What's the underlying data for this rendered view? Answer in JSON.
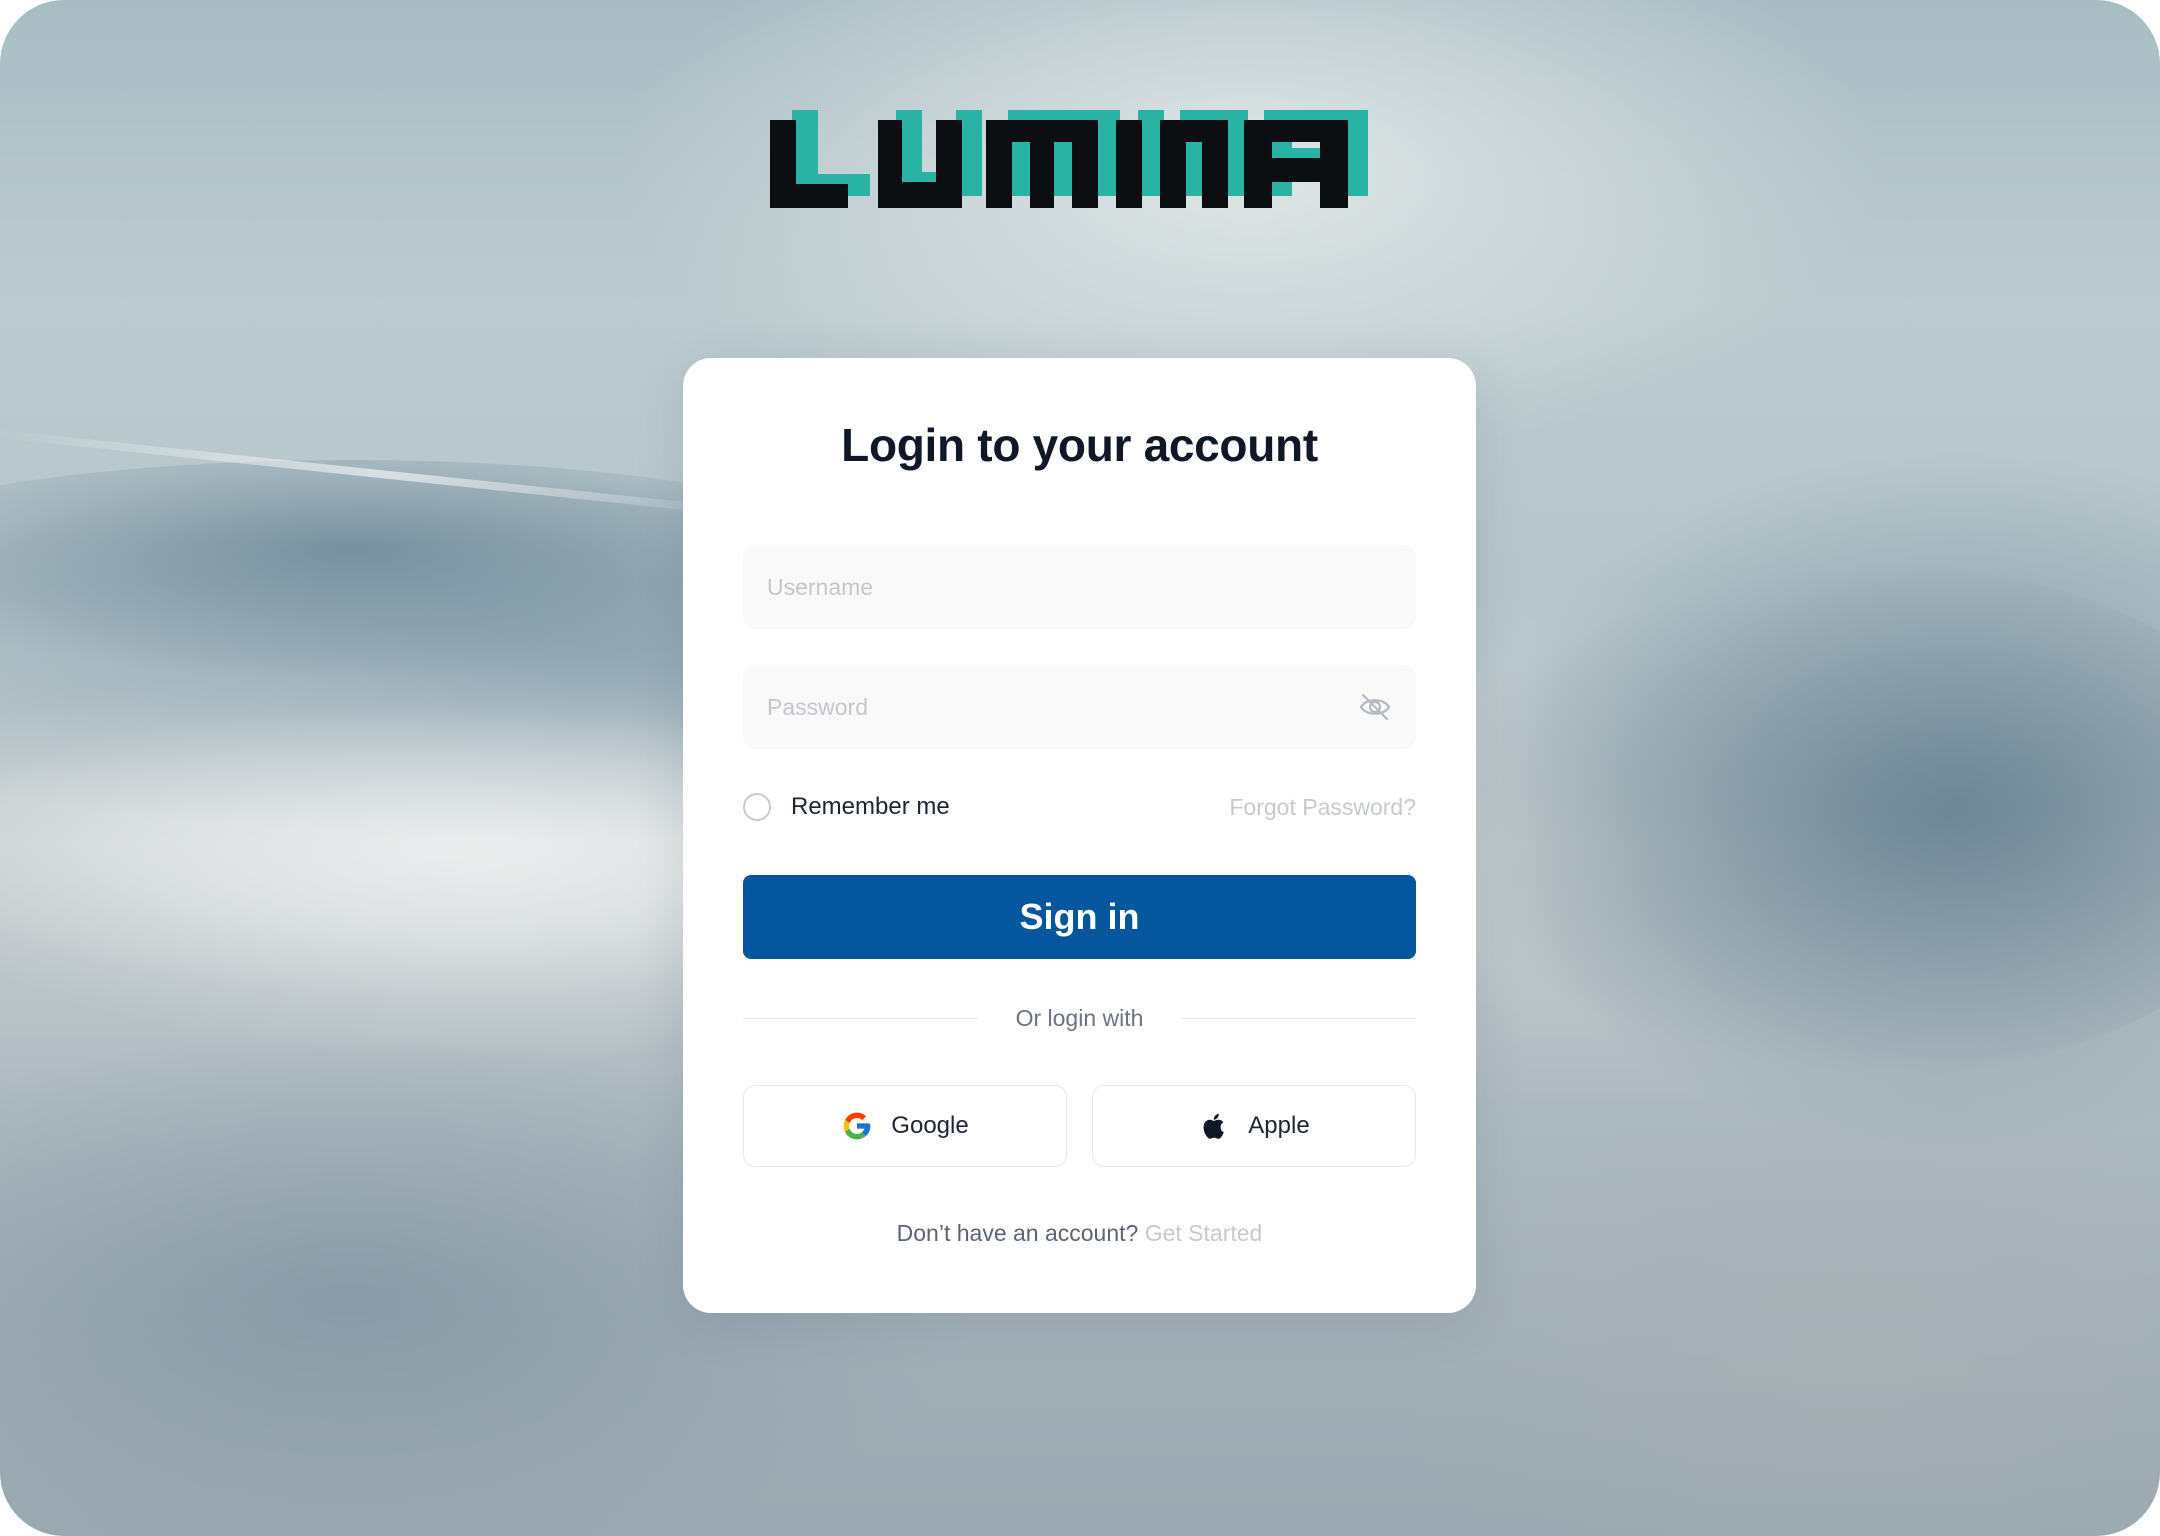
{
  "brand": {
    "logo_text": "LUMINA",
    "colors": {
      "primary": "#04569f",
      "logo_dark": "#0b0f12",
      "logo_accent": "#2ab3a4"
    }
  },
  "login": {
    "title": "Login to your account",
    "username_placeholder": "Username",
    "username_value": "",
    "password_placeholder": "Password",
    "password_value": "",
    "password_toggle_icon": "eye-off-icon",
    "remember_label": "Remember me",
    "remember_checked": false,
    "forgot_label": "Forgot Password?",
    "signin_label": "Sign in",
    "divider_text": "Or login with",
    "social": [
      {
        "label": "Google",
        "icon": "google-icon"
      },
      {
        "label": "Apple",
        "icon": "apple-icon"
      }
    ],
    "footer_question": "Don’t have an account?",
    "footer_link": "Get Started"
  }
}
